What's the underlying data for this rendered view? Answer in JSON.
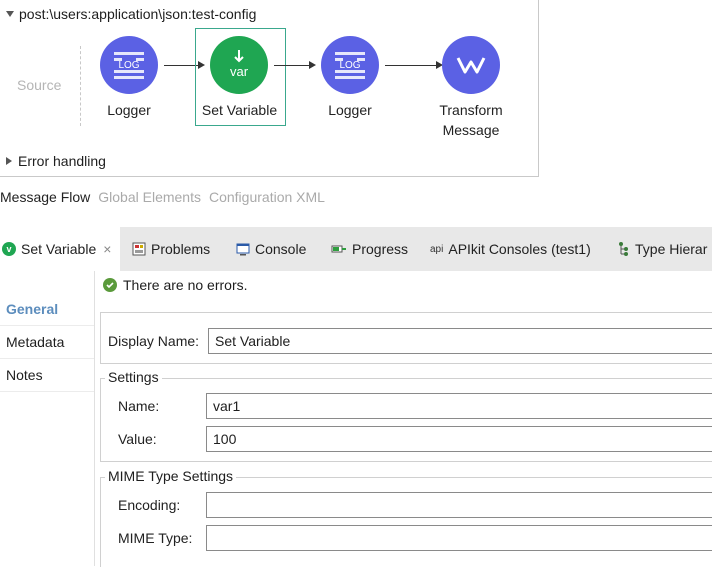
{
  "flow": {
    "title": "post:\\users:application\\json:test-config",
    "source_label": "Source",
    "nodes": [
      {
        "label": "Logger",
        "icon": "log-icon",
        "color": "#5b61e4"
      },
      {
        "label": "Set Variable",
        "icon": "var-icon",
        "color": "#1fa652"
      },
      {
        "label": "Logger",
        "icon": "log-icon",
        "color": "#5b61e4"
      },
      {
        "label": "Transform",
        "label2": "Message",
        "icon": "transform-icon",
        "color": "#5b61e4"
      }
    ],
    "icon_text_log": "LOG",
    "icon_text_var": "var",
    "error_handling": "Error handling"
  },
  "editor_tabs": [
    "Message Flow",
    "Global Elements",
    "Configuration XML"
  ],
  "panel_tabs": [
    {
      "label": "Set Variable",
      "icon": "set-variable-icon"
    },
    {
      "label": "Problems",
      "icon": "problems-icon"
    },
    {
      "label": "Console",
      "icon": "console-icon"
    },
    {
      "label": "Progress",
      "icon": "progress-icon"
    },
    {
      "label": "APIkit Consoles (test1)",
      "icon": "api-icon",
      "icon_text": "api"
    },
    {
      "label": "Type Hierar",
      "icon": "type-hierarchy-icon"
    }
  ],
  "left_nav": [
    "General",
    "Metadata",
    "Notes"
  ],
  "status": "There are no errors.",
  "form": {
    "display_name_label": "Display Name:",
    "display_name_value": "Set Variable",
    "settings_title": "Settings",
    "name_label": "Name:",
    "name_value": "var1",
    "value_label": "Value:",
    "value_value": "100",
    "mime_title": "MIME Type Settings",
    "encoding_label": "Encoding:",
    "encoding_value": "",
    "mime_type_label": "MIME Type:",
    "mime_type_value": ""
  },
  "colors": {
    "accent": "#5c8dbd",
    "logger": "#5b61e4",
    "set_variable": "#1fa652",
    "selection": "#3aa88d"
  }
}
